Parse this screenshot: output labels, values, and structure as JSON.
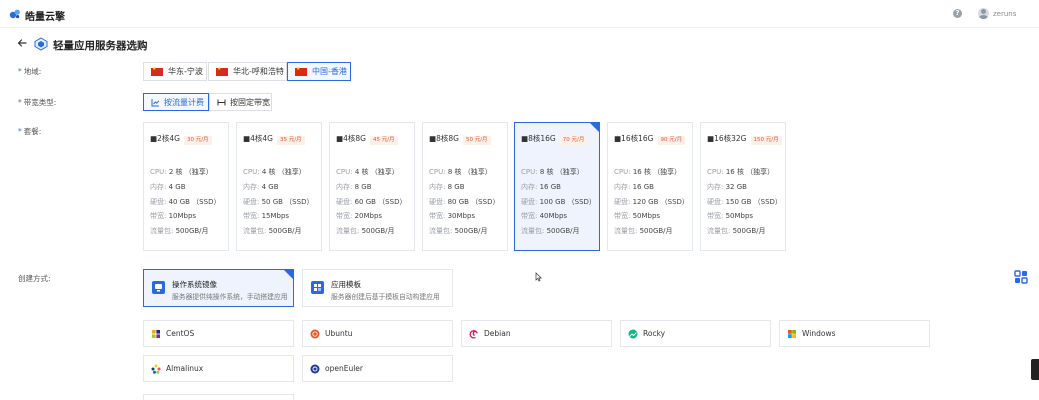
{
  "header": {
    "brand": "皓量云擎",
    "username": "zeruns",
    "help_glyph": "?"
  },
  "page": {
    "title": "轻量应用服务器选购"
  },
  "labels": {
    "region": "地域:",
    "bandwidth_type": "带宽类型:",
    "package": "套餐:",
    "create_method": "创建方式:",
    "required_mark": "*"
  },
  "regions": [
    {
      "name": "华东-宁波",
      "active": false
    },
    {
      "name": "华北-呼和浩特",
      "active": false
    },
    {
      "name": "中国-香港",
      "active": true
    }
  ],
  "bandwidth": [
    {
      "name": "按流量计费",
      "active": true
    },
    {
      "name": "按固定带宽",
      "active": false
    }
  ],
  "spec_keys": {
    "cpu": "CPU:",
    "memory": "内存:",
    "disk": "硬盘:",
    "bandwidth": "带宽:",
    "traffic": "流量包:"
  },
  "packages": [
    {
      "name": "■2核4G",
      "price": "30 元/月",
      "cpu": "2 核 （独享）",
      "memory": "4 GB",
      "disk": "40 GB （SSD）",
      "bandwidth": "10Mbps",
      "traffic": "500GB/月",
      "active": false
    },
    {
      "name": "■4核4G",
      "price": "35 元/月",
      "cpu": "4 核 （独享）",
      "memory": "4 GB",
      "disk": "50 GB （SSD）",
      "bandwidth": "15Mbps",
      "traffic": "500GB/月",
      "active": false
    },
    {
      "name": "■4核8G",
      "price": "45 元/月",
      "cpu": "4 核 （独享）",
      "memory": "8 GB",
      "disk": "60 GB （SSD）",
      "bandwidth": "20Mbps",
      "traffic": "500GB/月",
      "active": false
    },
    {
      "name": "■8核8G",
      "price": "50 元/月",
      "cpu": "8 核 （独享）",
      "memory": "8 GB",
      "disk": "80 GB （SSD）",
      "bandwidth": "30Mbps",
      "traffic": "500GB/月",
      "active": false
    },
    {
      "name": "■8核16G",
      "price": "70 元/月",
      "cpu": "8 核 （独享）",
      "memory": "16 GB",
      "disk": "100 GB （SSD）",
      "bandwidth": "40Mbps",
      "traffic": "500GB/月",
      "active": true
    },
    {
      "name": "■16核16G",
      "price": "90 元/月",
      "cpu": "16 核 （独享）",
      "memory": "16 GB",
      "disk": "120 GB （SSD）",
      "bandwidth": "50Mbps",
      "traffic": "500GB/月",
      "active": false
    },
    {
      "name": "■16核32G",
      "price": "150 元/月",
      "cpu": "16 核 （独享）",
      "memory": "32 GB",
      "disk": "150 GB （SSD）",
      "bandwidth": "50Mbps",
      "traffic": "500GB/月",
      "active": false
    }
  ],
  "methods": [
    {
      "title": "操作系统镜像",
      "desc": "服务器提供纯操作系统，手动搭建应用",
      "active": true
    },
    {
      "title": "应用模板",
      "desc": "服务器创建后基于模板自动构建应用",
      "active": false
    }
  ],
  "os_images": [
    {
      "name": "CentOS",
      "icon": "centos-icon"
    },
    {
      "name": "Ubuntu",
      "icon": "ubuntu-icon"
    },
    {
      "name": "Debian",
      "icon": "debian-icon"
    },
    {
      "name": "Rocky",
      "icon": "rocky-icon"
    },
    {
      "name": "Windows",
      "icon": "windows-icon"
    },
    {
      "name": "Almalinux",
      "icon": "almalinux-icon"
    },
    {
      "name": "openEuler",
      "icon": "openeuler-icon"
    }
  ],
  "colors": {
    "accent": "#2a6ae0",
    "price": "#e8572a"
  }
}
